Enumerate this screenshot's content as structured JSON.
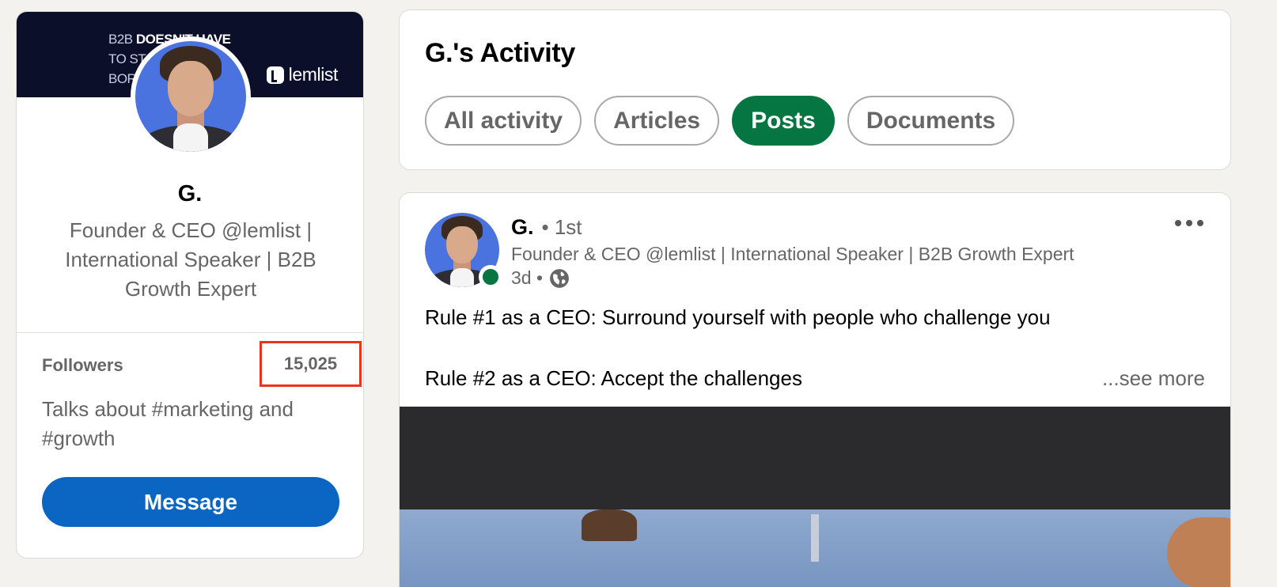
{
  "profile": {
    "banner_tagline_light_1": "B2B ",
    "banner_tagline_bold": "DOESN'T HAVE",
    "banner_tagline_light_2": "TO STAY\nBORING",
    "banner_brand": "lemlist",
    "name": "G.",
    "headline": "Founder & CEO @lemlist | International Speaker | B2B Growth Expert",
    "followers_label": "Followers",
    "followers_count": "15,025",
    "talks_about": "Talks about #marketing and #growth",
    "message_button": "Message"
  },
  "activity": {
    "title": "G.'s Activity",
    "filters": [
      {
        "label": "All activity",
        "active": false
      },
      {
        "label": "Articles",
        "active": false
      },
      {
        "label": "Posts",
        "active": true
      },
      {
        "label": "Documents",
        "active": false
      }
    ]
  },
  "post": {
    "author_name": "G.",
    "author_degree": "• 1st",
    "author_headline": "Founder & CEO @lemlist | International Speaker | B2B Growth Expert",
    "time": "3d •",
    "visibility_icon": "globe-icon",
    "line1": "Rule #1 as a CEO: Surround yourself with people who challenge you",
    "line2": "Rule #2 as a CEO: Accept the challenges",
    "see_more": "...see more"
  },
  "colors": {
    "accent_green": "#057642",
    "message_blue": "#0a66c2",
    "highlight_red": "#e8341c",
    "banner_navy": "#0c0f2a"
  }
}
